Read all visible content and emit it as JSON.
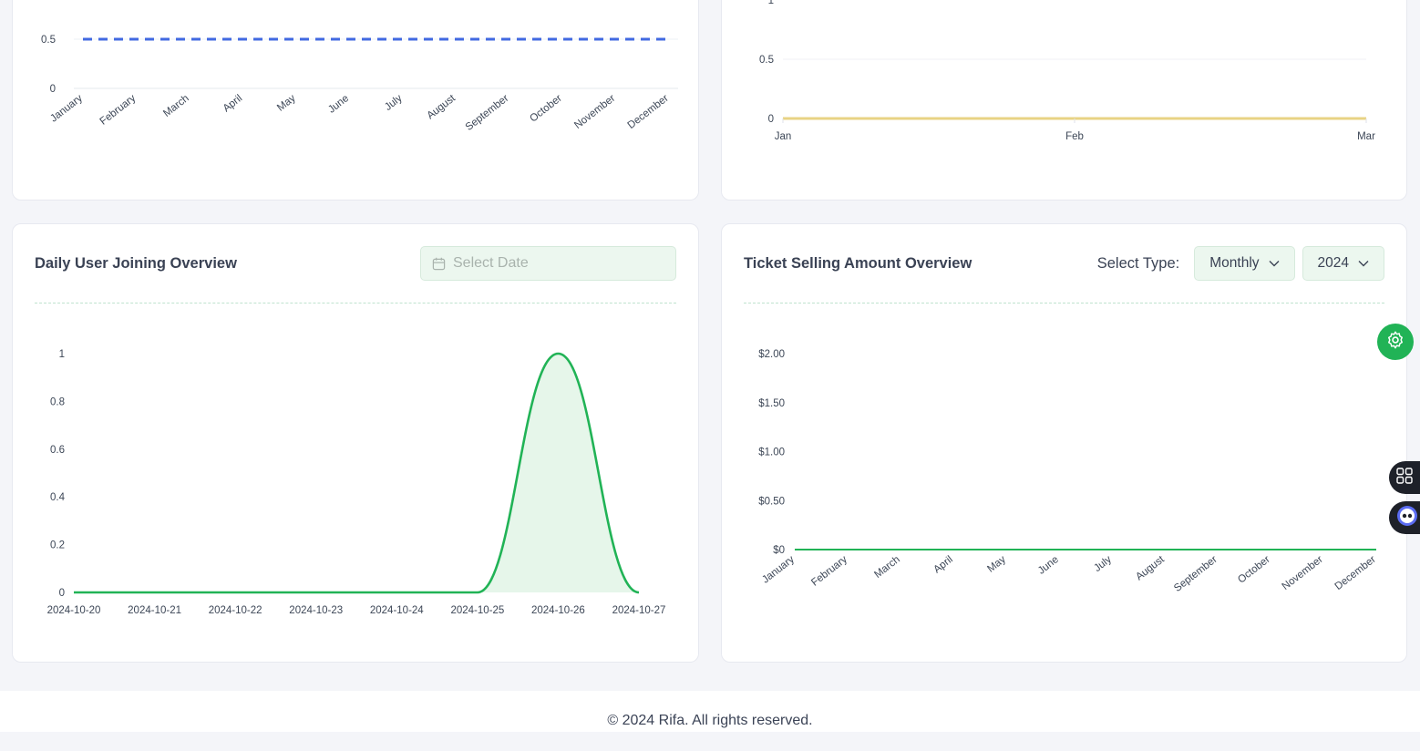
{
  "colors": {
    "accent_green": "#21b356",
    "series_blue": "#4169e1",
    "series_yellow": "#e8d384",
    "fill_green": "#e6f6ea"
  },
  "top_left_chart": {
    "ticks_y": [
      "0.5",
      "0"
    ]
  },
  "top_right_chart": {
    "ticks_y": [
      "1",
      "0.5",
      "0"
    ]
  },
  "daily_user": {
    "title": "Daily User Joining Overview",
    "date_placeholder": "Select Date",
    "calendar_icon": "calendar-icon"
  },
  "ticket_selling": {
    "title": "Ticket Selling Amount Overview",
    "select_type_label": "Select Type:",
    "type_value": "Monthly",
    "year_value": "2024"
  },
  "floating": {
    "settings_icon": "gear-icon",
    "apps_icon": "grid-icon",
    "assistant_icon": "bot-icon"
  },
  "footer": {
    "text": "© 2024 Rifa. All rights reserved."
  },
  "chart_data": [
    {
      "type": "line",
      "categories": [
        "January",
        "February",
        "March",
        "April",
        "May",
        "June",
        "July",
        "August",
        "September",
        "October",
        "November",
        "December"
      ],
      "series": [
        {
          "values": [
            0.5,
            0.5,
            0.5,
            0.5,
            0.5,
            0.5,
            0.5,
            0.5,
            0.5,
            0.5,
            0.5,
            0.5
          ]
        }
      ],
      "ylim": [
        0,
        0.5
      ],
      "style": "dashed"
    },
    {
      "type": "line",
      "categories": [
        "Jan",
        "Feb",
        "Mar"
      ],
      "series": [
        {
          "values": [
            0,
            0,
            0
          ]
        }
      ],
      "ylim": [
        0,
        1
      ]
    },
    {
      "type": "area",
      "title": "Daily User Joining Overview",
      "categories": [
        "2024-10-20",
        "2024-10-21",
        "2024-10-22",
        "2024-10-23",
        "2024-10-24",
        "2024-10-25",
        "2024-10-26",
        "2024-10-27"
      ],
      "series": [
        {
          "values": [
            0,
            0,
            0,
            0,
            0,
            0,
            1,
            0
          ]
        }
      ],
      "yticks": [
        "0",
        "0.2",
        "0.4",
        "0.6",
        "0.8",
        "1"
      ],
      "ylim": [
        0,
        1
      ]
    },
    {
      "type": "line",
      "title": "Ticket Selling Amount Overview",
      "categories": [
        "January",
        "February",
        "March",
        "April",
        "May",
        "June",
        "July",
        "August",
        "September",
        "October",
        "November",
        "December"
      ],
      "series": [
        {
          "values": [
            0,
            0,
            0,
            0,
            0,
            0,
            0,
            0,
            0,
            0,
            0,
            0
          ]
        }
      ],
      "yticks": [
        "$0",
        "$0.50",
        "$1.00",
        "$1.50",
        "$2.00"
      ],
      "ylim": [
        0,
        2
      ]
    }
  ]
}
